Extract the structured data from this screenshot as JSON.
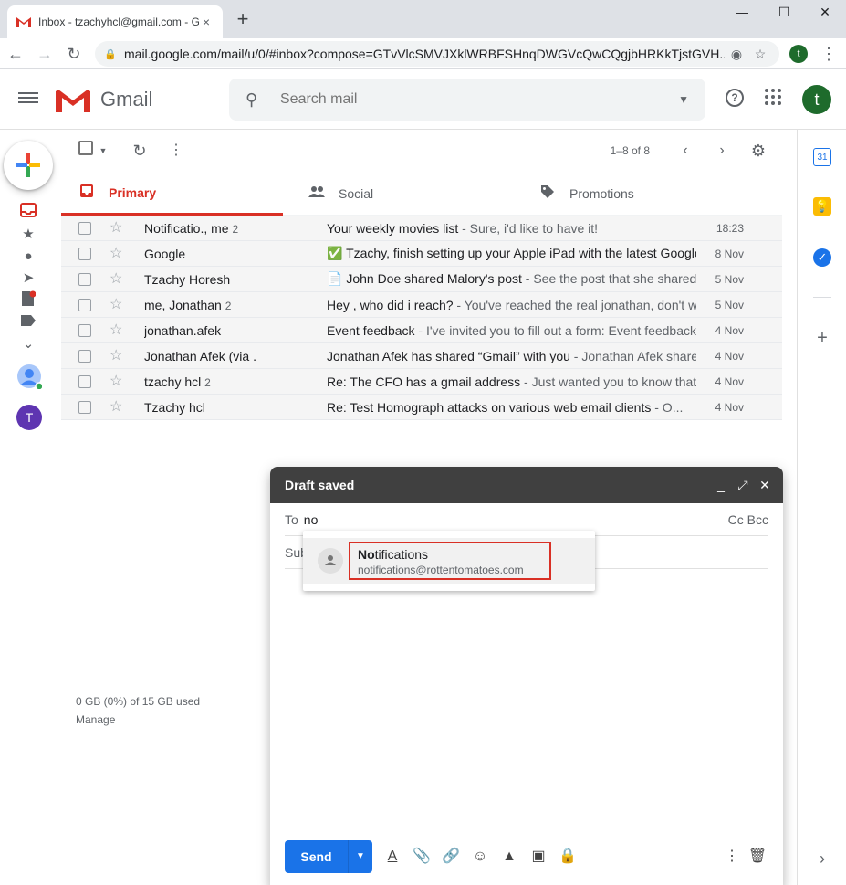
{
  "browser": {
    "tab_title": "Inbox - tzachyhcl@gmail.com - G",
    "tab_close": "×",
    "new_tab": "+",
    "url": "mail.google.com/mail/u/0/#inbox?compose=GTvVlcSMVJXklWRBFSHnqDWGVcQwCQgjbHRKkTjstGVH...",
    "profile_initial": "t",
    "minimize": "—",
    "maximize": "☐",
    "close": "✕"
  },
  "header": {
    "app_name": "Gmail",
    "search_placeholder": "Search mail",
    "account_initial": "t"
  },
  "toolbar": {
    "count_label": "1–8 of 8"
  },
  "tabs": [
    {
      "label": "Primary"
    },
    {
      "label": "Social"
    },
    {
      "label": "Promotions"
    }
  ],
  "emails": [
    {
      "sender": "Notificatio., me",
      "count": "2",
      "subject": "Your weekly movies list",
      "snippet": " - Sure, i'd like to have it!",
      "date": "18:23"
    },
    {
      "sender": "Google",
      "count": "",
      "subject": "✅ Tzachy, finish setting up your Apple iPad with the latest Google apps",
      "snippet": "",
      "date": "8 Nov"
    },
    {
      "sender": "Tzachy Horesh",
      "count": "",
      "subject": "📄 John Doe shared Malory's post",
      "snippet": " - See the post that she shared",
      "date": "5 Nov"
    },
    {
      "sender": "me, Jonathan",
      "count": "2",
      "subject": "Hey , who did i reach?",
      "snippet": " - You've reached the real jonathan, don't worry",
      "date": "5 Nov"
    },
    {
      "sender": "jonathan.afek",
      "count": "",
      "subject": "Event feedback",
      "snippet": " - I've invited you to fill out a form: Event feedback",
      "date": "4 Nov"
    },
    {
      "sender": "Jonathan Afek (via .",
      "count": "",
      "subject": "Jonathan Afek has shared “Gmail” with you",
      "snippet": " - Jonathan Afek shared",
      "date": "4 Nov"
    },
    {
      "sender": "tzachy hcl",
      "count": "2",
      "subject": "Re: The CFO has a gmail address",
      "snippet": " - Just wanted you to know that",
      "date": "4 Nov"
    },
    {
      "sender": "Tzachy hcl",
      "count": "",
      "subject": "Re: Test Homograph attacks on various web email clients",
      "snippet": " - O...",
      "date": "4 Nov"
    }
  ],
  "storage": {
    "usage": "0 GB (0%) of 15 GB used",
    "manage": "Manage"
  },
  "compose": {
    "title": "Draft saved",
    "to_label": "To",
    "to_value": "no",
    "cc_bcc": "Cc Bcc",
    "subject_label": "Sub",
    "send_label": "Send"
  },
  "suggestion": {
    "name_match": "No",
    "name_rest": "tifications",
    "email": "notifications@rottentomatoes.com"
  },
  "side_panel": {
    "calendar_day": "31",
    "add": "+",
    "expand": "›"
  },
  "colors": {
    "accent": "#d93025",
    "send_blue": "#1a73e8",
    "compose_header": "#404040"
  }
}
